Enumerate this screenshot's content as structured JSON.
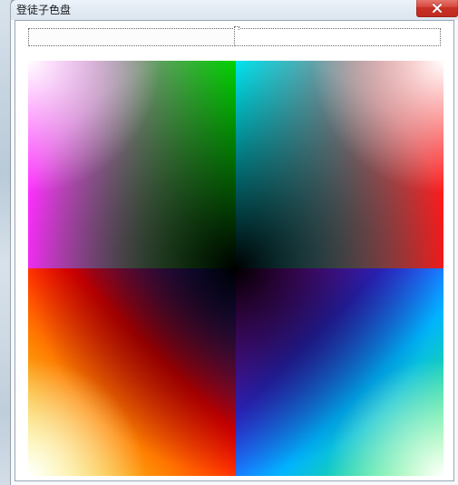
{
  "window": {
    "title": "登徒子色盘"
  },
  "tabs": [
    {
      "label": ""
    },
    {
      "label": ""
    }
  ],
  "palette": {
    "quadrants": [
      {
        "corner_colors": {
          "tl": "#ffffff",
          "tr": "#00ff00",
          "bl": "#ff00ff",
          "br": "#000000"
        }
      },
      {
        "corner_colors": {
          "tl": "#00ffff",
          "tr": "#ffffff",
          "bl": "#000000",
          "br": "#ff0000"
        }
      },
      {
        "corner_colors": {
          "tl": "#ff0000",
          "tr": "#000000",
          "bl": "#ffffff",
          "br": "#ffff00"
        }
      },
      {
        "corner_colors": {
          "tl": "#000000",
          "tr": "#ff00ff",
          "bl": "#00ff00",
          "br": "#ffffff"
        }
      }
    ]
  },
  "win_buttons": {
    "close_icon": "close-icon"
  }
}
